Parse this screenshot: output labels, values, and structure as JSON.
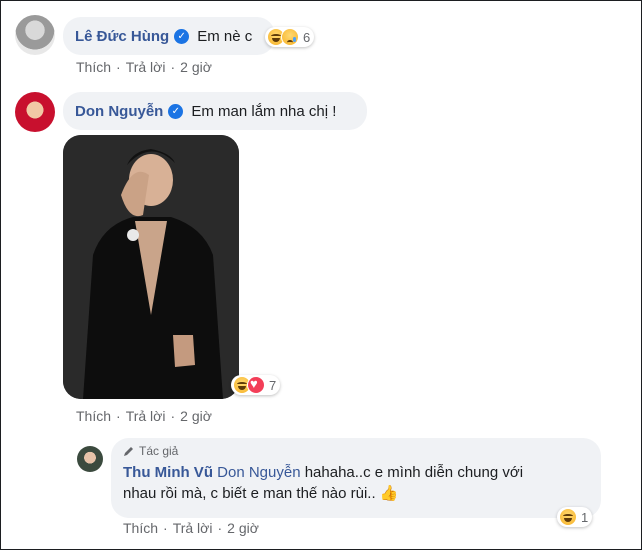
{
  "comments": [
    {
      "author": "Lê Đức Hùng",
      "text": "Em nè c",
      "reaction_count": "6",
      "actions": {
        "like": "Thích",
        "reply": "Trả lời",
        "time": "2 giờ"
      }
    },
    {
      "author": "Don Nguyễn",
      "text": "Em man lắm nha chị !",
      "reaction_count": "7",
      "actions": {
        "like": "Thích",
        "reply": "Trả lời",
        "time": "2 giờ"
      }
    }
  ],
  "reply": {
    "badge": "Tác giả",
    "author": "Thu Minh Vũ",
    "mention": "Don Nguyễn",
    "text_line1": " hahaha..c e mình diễn chung với",
    "text_line2": "nhau rồi mà, c biết e man thế nào rùi..",
    "emoji": "👍",
    "reaction_count": "1",
    "actions": {
      "like": "Thích",
      "reply": "Trả lời",
      "time": "2 giờ"
    }
  },
  "colors": {
    "name": "#385898",
    "bubble": "#f0f2f5",
    "meta": "#65676b",
    "verified": "#1b74e4"
  }
}
